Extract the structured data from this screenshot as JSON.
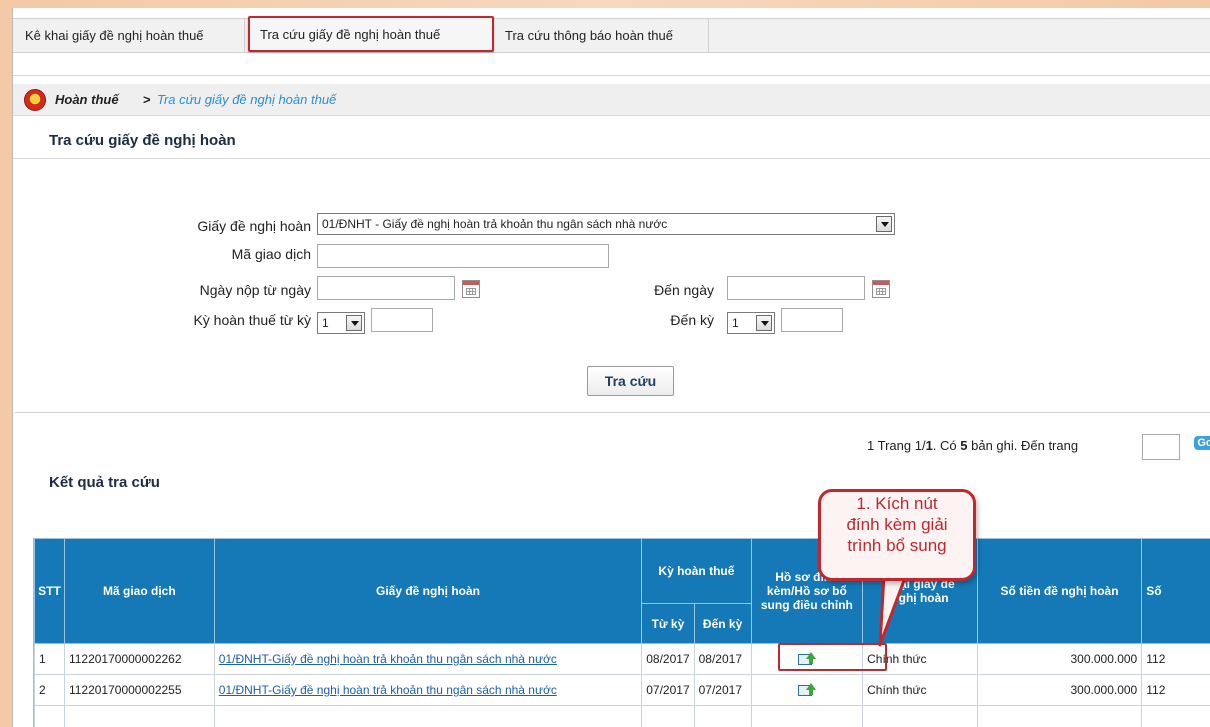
{
  "tabs": [
    {
      "label": "Kê khai giấy đề nghị hoàn thuế"
    },
    {
      "label": "Tra cứu giấy đề nghị hoàn thuế"
    },
    {
      "label": "Tra cứu thông báo hoàn thuế"
    }
  ],
  "breadcrumb": {
    "root": "Hoàn thuế",
    "separator": ">",
    "current": "Tra cứu giấy đề nghị hoàn thuế"
  },
  "search": {
    "title": "Tra cứu giấy đề nghị hoàn",
    "doc_type_label": "Giấy đề nghị hoàn",
    "doc_type_value": "01/ĐNHT - Giấy đề nghị hoàn trả khoản thu ngân sách nhà nước",
    "txn_code_label": "Mã giao dịch",
    "txn_code_value": "",
    "submit_from_label": "Ngày nộp từ ngày",
    "submit_to_label": "Đến ngày",
    "period_from_label": "Kỳ hoàn thuế từ kỳ",
    "period_from_value": "1",
    "period_to_label": "Đến kỳ",
    "period_to_value": "1",
    "button_label": "Tra cứu"
  },
  "pager": {
    "page": "1",
    "prefix": "Trang 1/",
    "total_pages": "1",
    "mid": ". Có ",
    "count": "5",
    "suffix": " bản ghi. Đến trang",
    "go_label": "Go"
  },
  "results": {
    "title": "Kết quả tra cứu",
    "headers": {
      "stt": "STT",
      "code": "Mã giao dịch",
      "doc": "Giấy đề nghị hoàn",
      "period": "Kỳ hoàn thuế",
      "from": "Từ kỳ",
      "to": "Đến kỳ",
      "attach_line1": "Hồ sơ đính",
      "attach_line2": "kèm/Hồ sơ bổ",
      "attach_line3": "sung điều chỉnh",
      "type_line1": "Loại giấy đề",
      "type_line2": "nghị hoàn",
      "amount": "Số tiền đề nghị hoàn",
      "extra": "Số"
    },
    "rows": [
      {
        "stt": "1",
        "code": "11220170000002262",
        "doc": "01/ĐNHT-Giấy đề nghị hoàn trả khoản thu ngân sách nhà nước",
        "from": "08/2017",
        "to": "08/2017",
        "type": "Chính thức",
        "amount": "300.000.000",
        "extra": "112"
      },
      {
        "stt": "2",
        "code": "11220170000002255",
        "doc": "01/ĐNHT-Giấy đề nghị hoàn trả khoản thu ngân sách nhà nước",
        "from": "07/2017",
        "to": "07/2017",
        "type": "Chính thức",
        "amount": "300.000.000",
        "extra": "112"
      }
    ]
  },
  "callout": {
    "line1": "1. Kích nút",
    "line2": "đính kèm giải",
    "line3": "trình bổ sung"
  },
  "colors": {
    "header_blue": "#1579b8",
    "accent_red": "#c0282d",
    "link_blue": "#1a5fb4",
    "breadcrumb_blue": "#2a8ed6"
  },
  "icons": {
    "crest": "crest-icon",
    "calendar": "calendar-icon",
    "attach": "attach-upload-icon",
    "dropdown": "chevron-down-icon"
  }
}
